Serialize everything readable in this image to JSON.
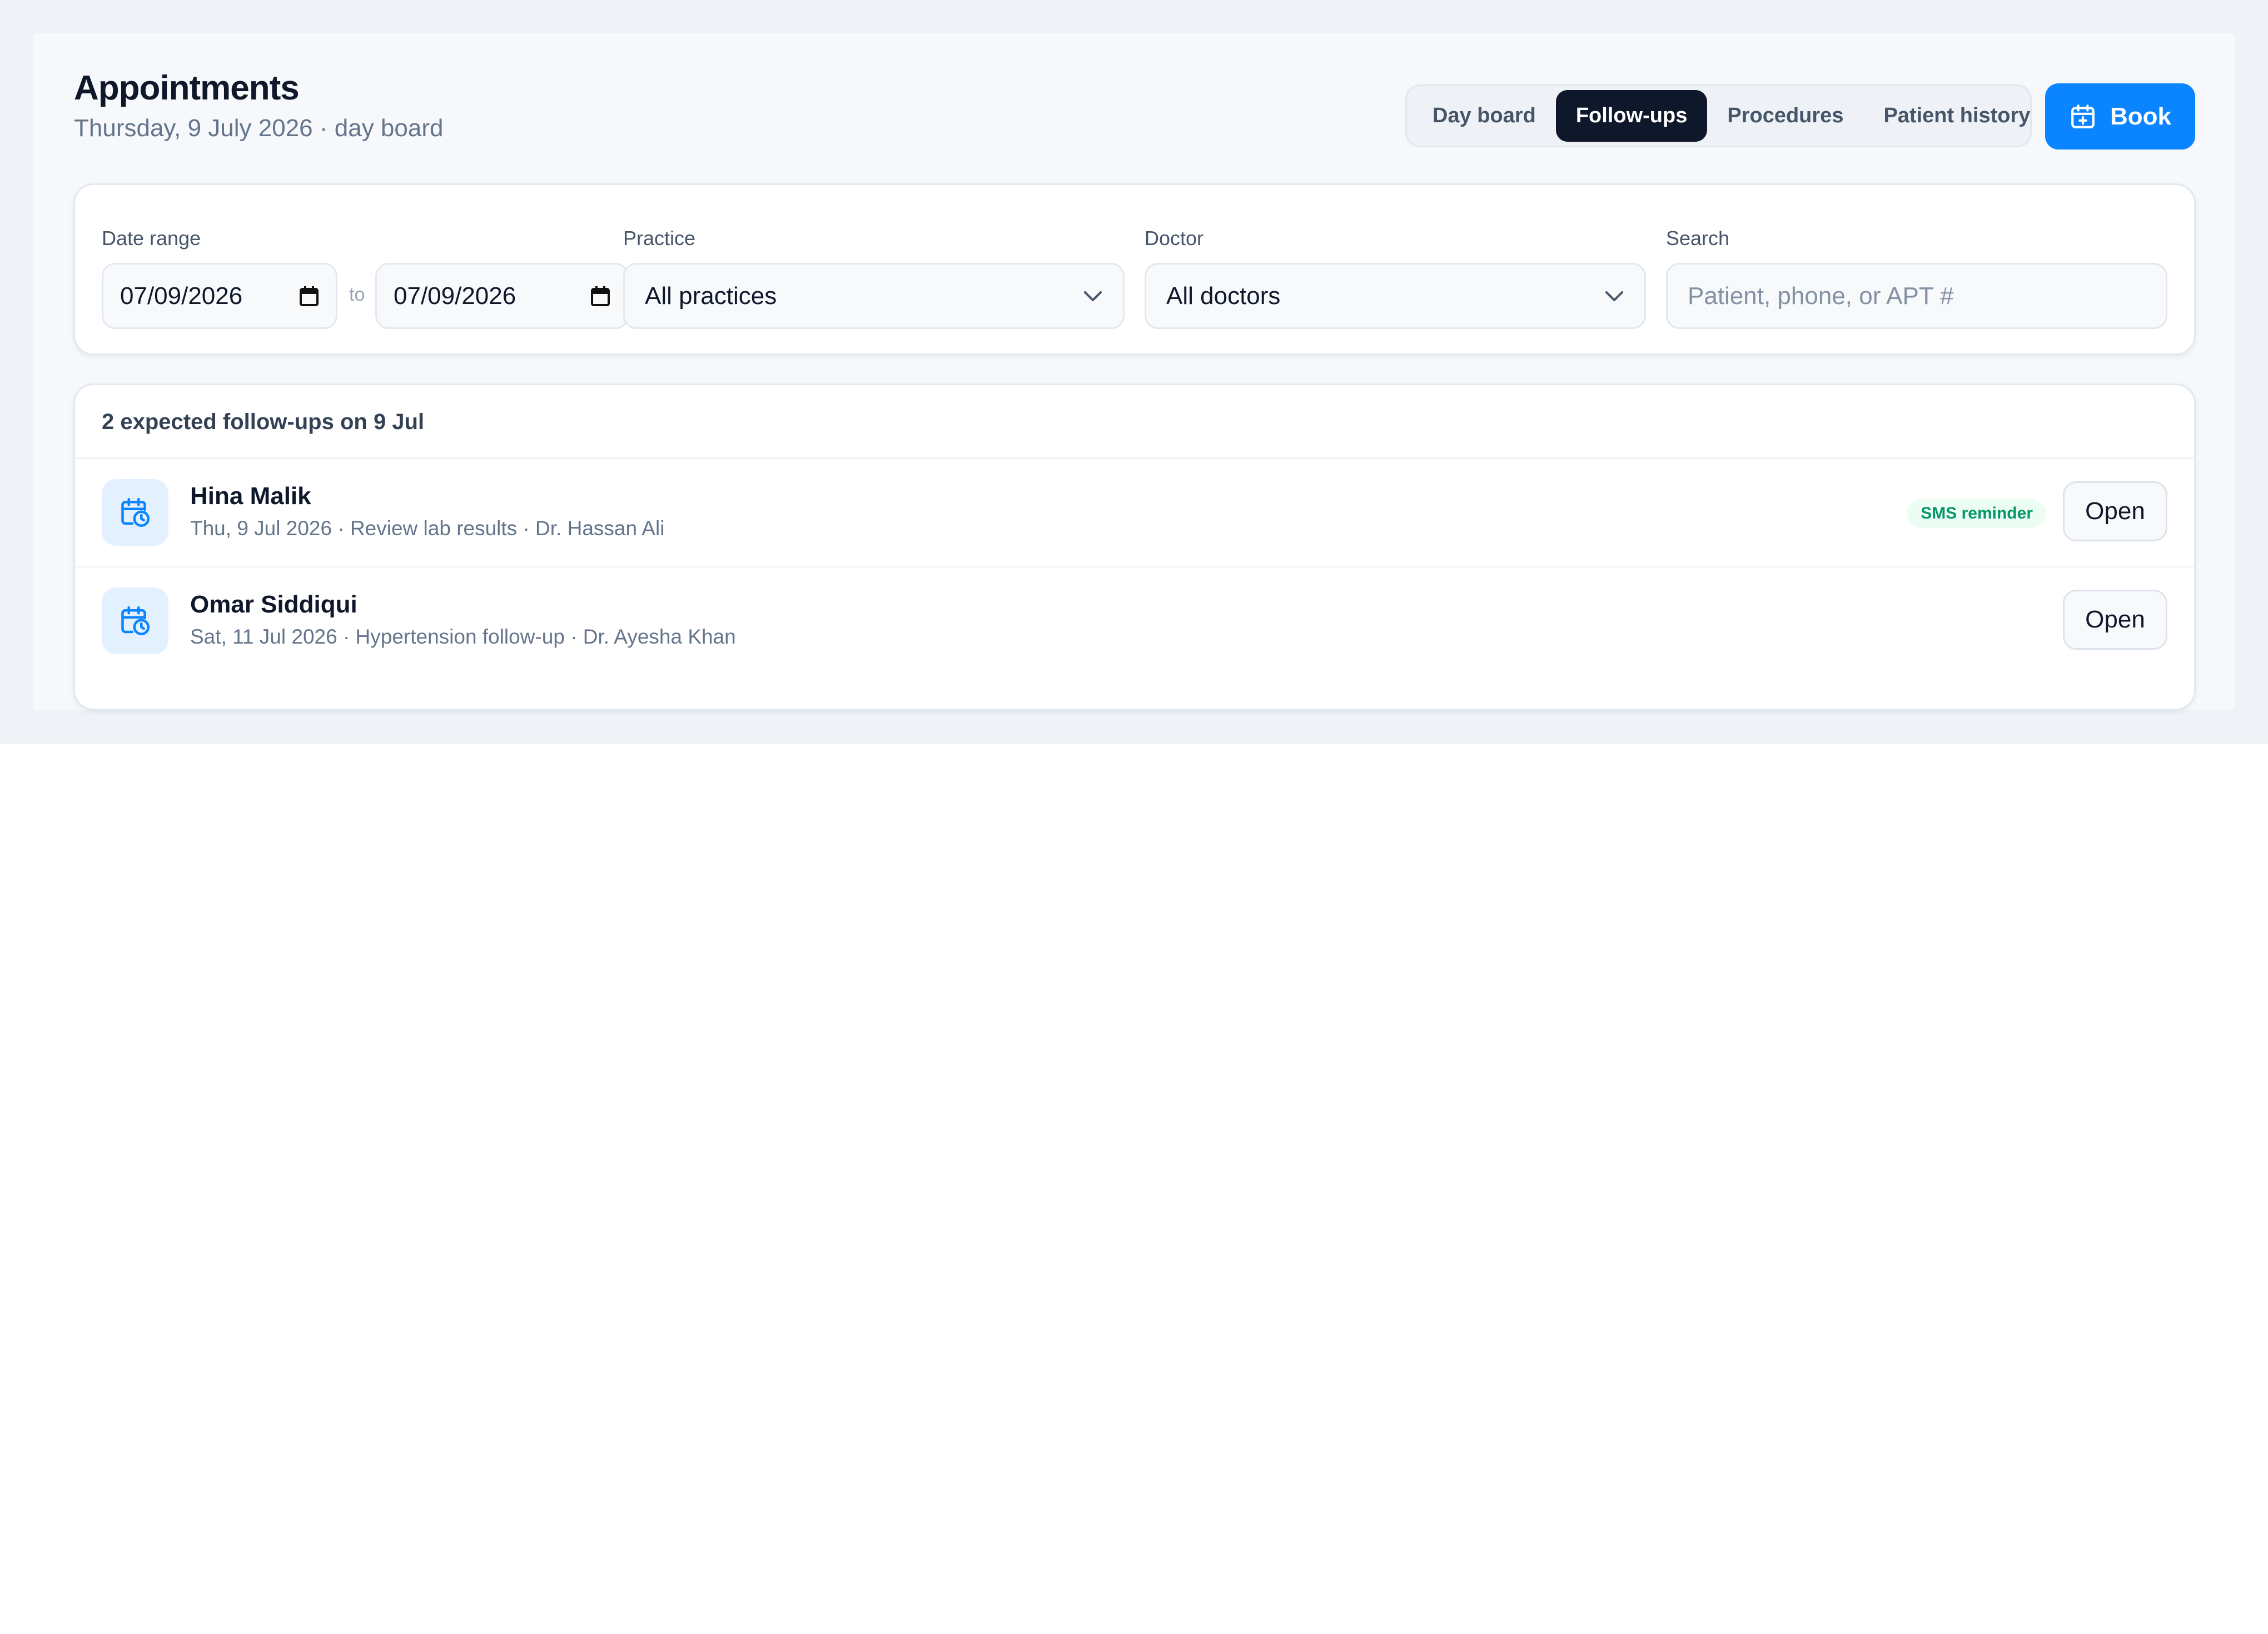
{
  "header": {
    "title": "Appointments",
    "subtitle": "Thursday, 9 July 2026 · day board"
  },
  "tabs": [
    {
      "label": "Day board",
      "active": false
    },
    {
      "label": "Follow-ups",
      "active": true
    },
    {
      "label": "Procedures",
      "active": false
    },
    {
      "label": "Patient history",
      "active": false
    }
  ],
  "book_button": {
    "label": "Book",
    "icon": "calendar-plus-icon"
  },
  "filters": {
    "date_range": {
      "label": "Date range",
      "from": "07/09/2026",
      "separator": "to",
      "to": "07/09/2026"
    },
    "practice": {
      "label": "Practice",
      "value": "All practices"
    },
    "doctor": {
      "label": "Doctor",
      "value": "All doctors"
    },
    "search": {
      "label": "Search",
      "placeholder": "Patient, phone, or APT #"
    }
  },
  "followups": {
    "heading": "2 expected follow-ups on 9 Jul",
    "items": [
      {
        "name": "Hina Malik",
        "meta": "Thu, 9 Jul 2026 · Review lab results · Dr. Hassan Ali",
        "badge": "SMS reminder",
        "action": "Open"
      },
      {
        "name": "Omar Siddiqui",
        "meta": "Sat, 11 Jul 2026 · Hypertension follow-up · Dr. Ayesha Khan",
        "action": "Open"
      }
    ]
  },
  "colors": {
    "accent": "#0a84ff",
    "active_tab": "#0f172a",
    "badge_text": "#059669",
    "badge_bg": "#ecfdf3"
  }
}
